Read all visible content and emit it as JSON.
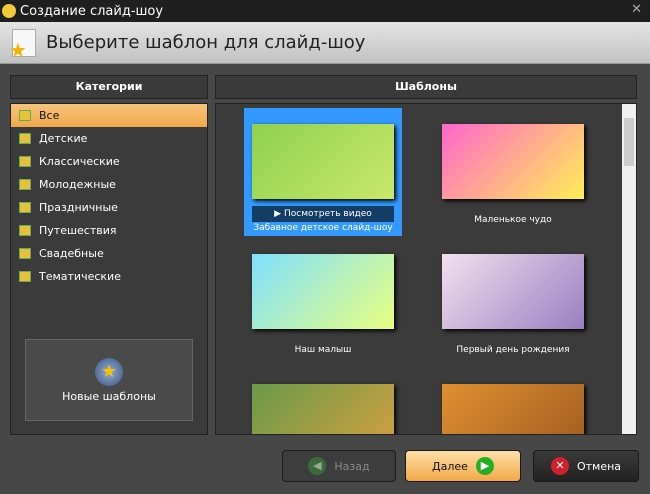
{
  "window": {
    "title": "Создание слайд-шоу",
    "close": "✕"
  },
  "header": {
    "title": "Выберите шаблон для слайд-шоу"
  },
  "categories": {
    "title": "Категории",
    "items": [
      "Все",
      "Детские",
      "Классические",
      "Молодежные",
      "Праздничные",
      "Путешествия",
      "Свадебные",
      "Тематические"
    ],
    "selected": 0,
    "new_templates": "Новые шаблоны"
  },
  "templates": {
    "title": "Шаблоны",
    "play_label": "Посмотреть видео",
    "items": [
      {
        "label": "Забавное детское слайд-шоу",
        "colors": [
          "#8fd14f",
          "#c9e86a"
        ]
      },
      {
        "label": "Маленькое чудо",
        "colors": [
          "#ff66cc",
          "#ffee55"
        ]
      },
      {
        "label": "Наш малыш",
        "colors": [
          "#7fe0ff",
          "#e8ff80"
        ]
      },
      {
        "label": "Первый день рождения",
        "colors": [
          "#f3e0f0",
          "#9a7fc0"
        ]
      },
      {
        "label": "",
        "colors": [
          "#6a9a4a",
          "#d8a040"
        ]
      },
      {
        "label": "",
        "colors": [
          "#e09030",
          "#a05a20"
        ]
      }
    ]
  },
  "buttons": {
    "back": "Назад",
    "next": "Далее",
    "cancel": "Отмена"
  }
}
